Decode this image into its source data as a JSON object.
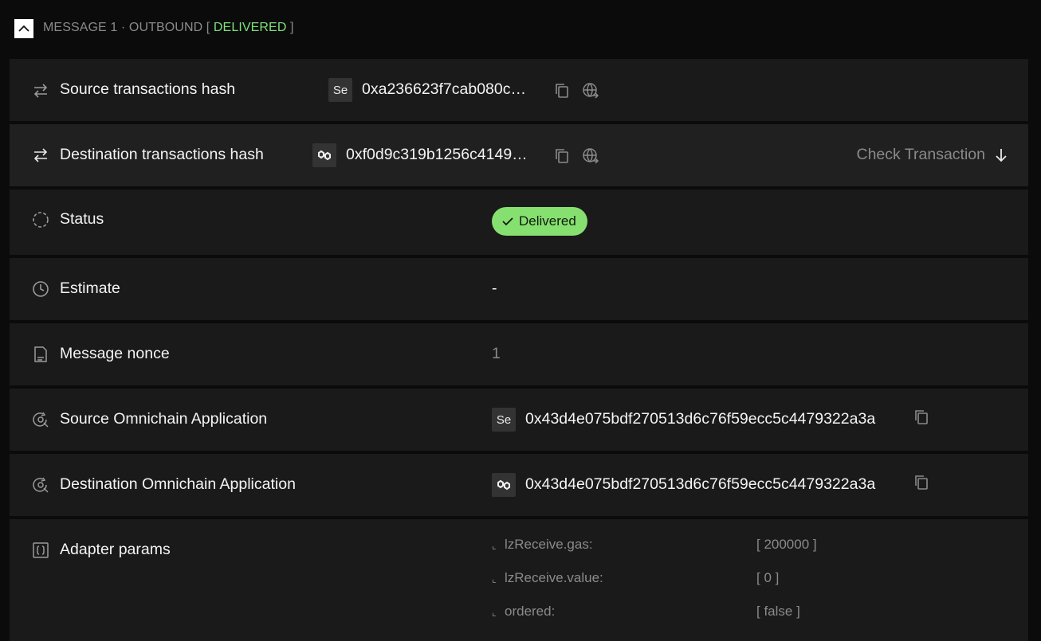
{
  "header": {
    "prefix": "MESSAGE 1 · OUTBOUND [ ",
    "status": "DELIVERED",
    "suffix": " ]",
    "status_color": "#7fe07a"
  },
  "rows": {
    "source_tx": {
      "label": "Source transactions hash",
      "chain_badge": "Se",
      "hash": "0xa236623f7cab080c…",
      "icon": "arrows-exchange-icon"
    },
    "dest_tx": {
      "label": "Destination transactions hash",
      "chain_icon": "polygon-chain-icon",
      "hash": "0xf0d9c319b1256c4149…",
      "check_label": "Check Transaction",
      "icon": "arrows-exchange-icon"
    },
    "status": {
      "label": "Status",
      "value": "Delivered",
      "pill_color": "#86e070",
      "icon": "loading-circle-icon"
    },
    "estimate": {
      "label": "Estimate",
      "value": "-",
      "icon": "clock-icon"
    },
    "nonce": {
      "label": "Message nonce",
      "value": "1",
      "icon": "document-icon"
    },
    "source_app": {
      "label": "Source Omnichain Application",
      "chain_badge": "Se",
      "address": "0x43d4e075bdf270513d6c76f59ecc5c4479322a3a",
      "icon": "app-refresh-icon"
    },
    "dest_app": {
      "label": "Destination Omnichain Application",
      "chain_icon": "polygon-chain-icon",
      "address": "0x43d4e075bdf270513d6c76f59ecc5c4479322a3a",
      "icon": "app-refresh-icon"
    },
    "adapter": {
      "label": "Adapter params",
      "icon": "brackets-icon",
      "params": [
        {
          "key": "lzReceive.gas:",
          "value": "[ 200000 ]"
        },
        {
          "key": "lzReceive.value:",
          "value": "[ 0 ]"
        },
        {
          "key": "ordered:",
          "value": "[ false ]"
        }
      ]
    }
  }
}
